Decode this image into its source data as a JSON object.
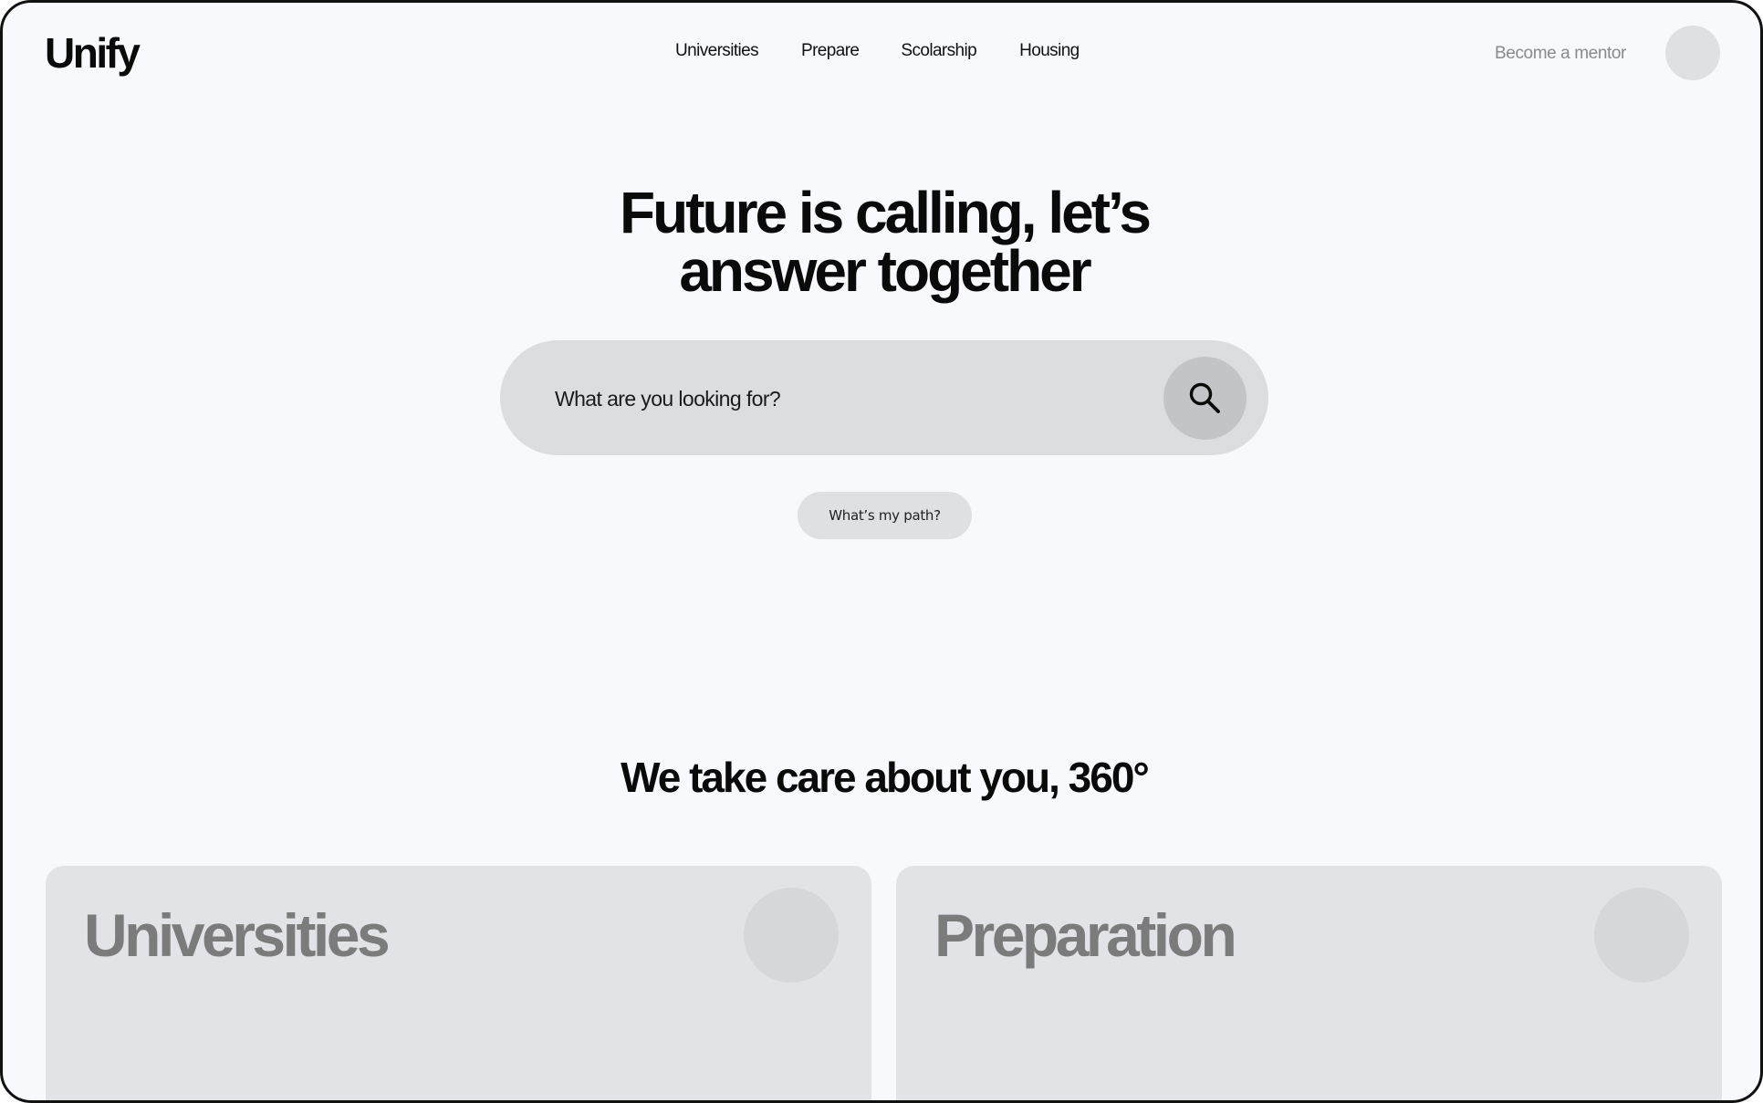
{
  "brand": {
    "logo": "Unify"
  },
  "nav": {
    "items": [
      {
        "label": "Universities"
      },
      {
        "label": "Prepare"
      },
      {
        "label": "Scolarship"
      },
      {
        "label": "Housing"
      }
    ],
    "mentor_label": "Become a mentor"
  },
  "hero": {
    "title_line1": "Future is calling, let’s",
    "title_line2": "answer together",
    "search_placeholder": "What are you looking for?",
    "path_button": "What’s my path?"
  },
  "section": {
    "title": "We take care about you, 360°",
    "cards": [
      {
        "title": "Universities"
      },
      {
        "title": "Preparation"
      }
    ]
  },
  "icons": {
    "search": "search-icon"
  },
  "colors": {
    "background": "#f8f9fd",
    "search_bar": "#dcdde1",
    "search_button": "#c3c4c8",
    "card": "#e2e3e6",
    "card_title": "#7b7b7b",
    "muted_text": "#8a8a8a"
  }
}
